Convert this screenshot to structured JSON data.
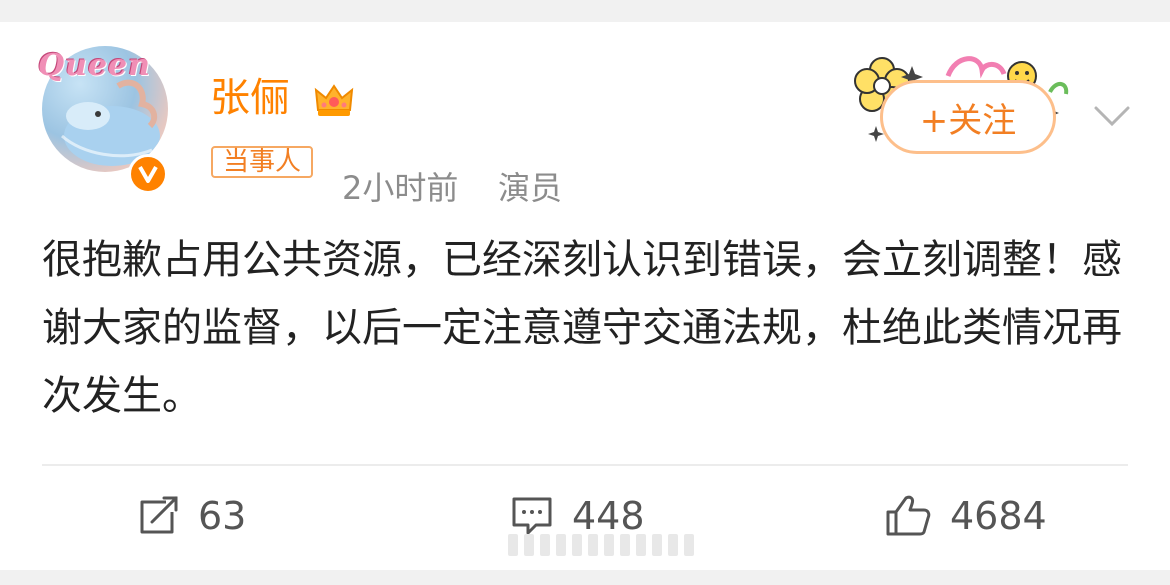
{
  "post": {
    "author": {
      "name": "张俪",
      "avatar_text": "Queen",
      "badge_icon": "crown-icon",
      "verified_icon": "verified-v-icon"
    },
    "tag": "当事人",
    "time": "2小时前",
    "occupation": "演员",
    "follow_label": "+关注",
    "text": "很抱歉占用公共资源，已经深刻认识到错误，会立刻调整！感谢大家的监督，以后一定注意遵守交通法规，杜绝此类情况再次发生。"
  },
  "actions": {
    "repost_count": "63",
    "comment_count": "448",
    "like_count": "4684"
  },
  "colors": {
    "accent": "#ff8200",
    "tag_border": "#f6a862",
    "text": "#222222",
    "meta": "#8c8c8c"
  }
}
